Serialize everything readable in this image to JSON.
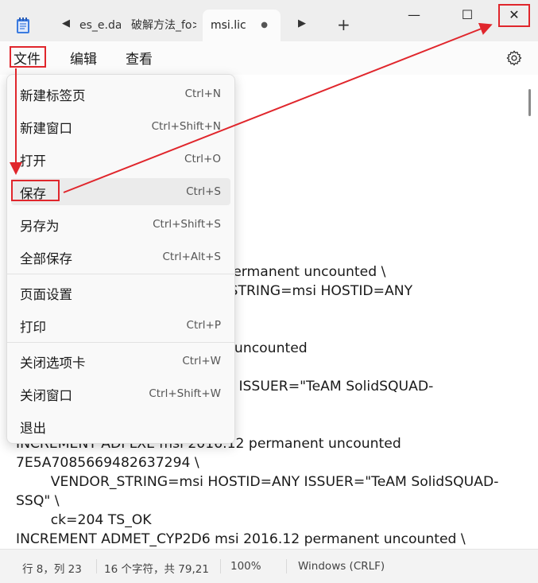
{
  "titlebar": {
    "tabs": [
      {
        "label": "es_e.da"
      },
      {
        "label": "破解方法_fo>"
      },
      {
        "label": "msi.lic",
        "close": "●"
      }
    ],
    "scroll_left": "◀",
    "scroll_right": "▶",
    "add_tab": "+",
    "minimize": "—",
    "maximize": "☐",
    "close": "✕"
  },
  "menubar": {
    "file": "文件",
    "edit": "编辑",
    "view": "查看"
  },
  "file_menu": {
    "items": [
      {
        "label": "新建标签页",
        "shortcut": "Ctrl+N"
      },
      {
        "label": "新建窗口",
        "shortcut": "Ctrl+Shift+N"
      },
      {
        "label": "打开",
        "shortcut": "Ctrl+O"
      },
      {
        "label": "保存",
        "shortcut": "Ctrl+S"
      },
      {
        "label": "另存为",
        "shortcut": "Ctrl+Shift+S"
      },
      {
        "label": "全部保存",
        "shortcut": "Ctrl+Alt+S"
      },
      {
        "label": "页面设置",
        "shortcut": ""
      },
      {
        "label": "打印",
        "shortcut": "Ctrl+P"
      },
      {
        "label": "关闭选项卡",
        "shortcut": "Ctrl+W"
      },
      {
        "label": "关闭窗口",
        "shortcut": "Ctrl+Shift+W"
      },
      {
        "label": "退出",
        "shortcut": ""
      }
    ]
  },
  "editor": {
    "text": "                                  NY 25100\n\n                                  2016.12 permanent uncounted \\\n                                  VENDOR_STRING=msi HOSTID=ANY\n\n                                  S_OK\n                                  ermanent uncounted\n\n                                  STID=ANY ISSUER=\"TeAM SolidSQUAD-\n\n\nINCREMENT ADI LXE msi 2016.12 permanent uncounted\n7E5A7085669482637294 \\\n        VENDOR_STRING=msi HOSTID=ANY ISSUER=\"TeAM SolidSQUAD-\nSSQ\" \\\n        ck=204 TS_OK\nINCREMENT ADMET_CYP2D6 msi 2016.12 permanent uncounted \\"
  },
  "statusbar": {
    "position": "行 8，列 23",
    "chars": "16 个字符，共 79,21",
    "zoom": "100%",
    "encoding": "Windows (CRLF)"
  },
  "colors": {
    "annotation": "#e0262c",
    "hover": "#ebebeb"
  }
}
